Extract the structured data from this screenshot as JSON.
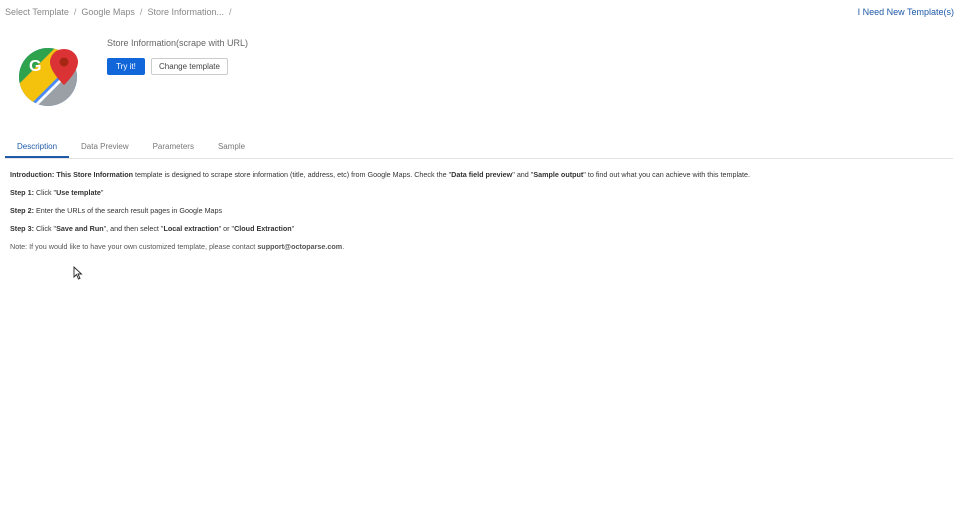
{
  "breadcrumb": {
    "items": [
      "Select Template",
      "Google Maps",
      "Store Information..."
    ],
    "separator": "/"
  },
  "need_template_link": "I Need New Template(s)",
  "template": {
    "title": "Store Information(scrape with URL)",
    "try_button": "Try it!",
    "change_button": "Change template"
  },
  "tabs": [
    {
      "label": "Description",
      "active": true
    },
    {
      "label": "Data Preview",
      "active": false
    },
    {
      "label": "Parameters",
      "active": false
    },
    {
      "label": "Sample",
      "active": false
    }
  ],
  "description": {
    "intro_label": "Introduction:",
    "intro_name": "This Store Information",
    "intro_text_1": " template is designed to scrape store information (title, address, etc) from Google Maps. Check the \"",
    "intro_link_1": "Data field preview",
    "intro_text_2": "\" and \"",
    "intro_link_2": "Sample output",
    "intro_text_3": "\" to find out what you can achieve with this template.",
    "step1_label": "Step 1:",
    "step1_text": " Click \"",
    "step1_bold": "Use template",
    "step1_end": "\"",
    "step2_label": "Step 2:",
    "step2_text": " Enter the URLs of the search result pages in Google Maps",
    "step3_label": "Step 3:",
    "step3_text_1": " Click \"",
    "step3_bold_1": "Save and Run",
    "step3_text_2": "\", and then select \"",
    "step3_bold_2": "Local extraction",
    "step3_text_3": "\" or \"",
    "step3_bold_3": "Cloud Extraction",
    "step3_end": "\"",
    "note_text": "Note: If you would like to have your own customized template, please contact ",
    "note_email": "support@octoparse.com",
    "note_end": "."
  },
  "colors": {
    "primary": "#1166d9",
    "link": "#1e5aa8"
  }
}
